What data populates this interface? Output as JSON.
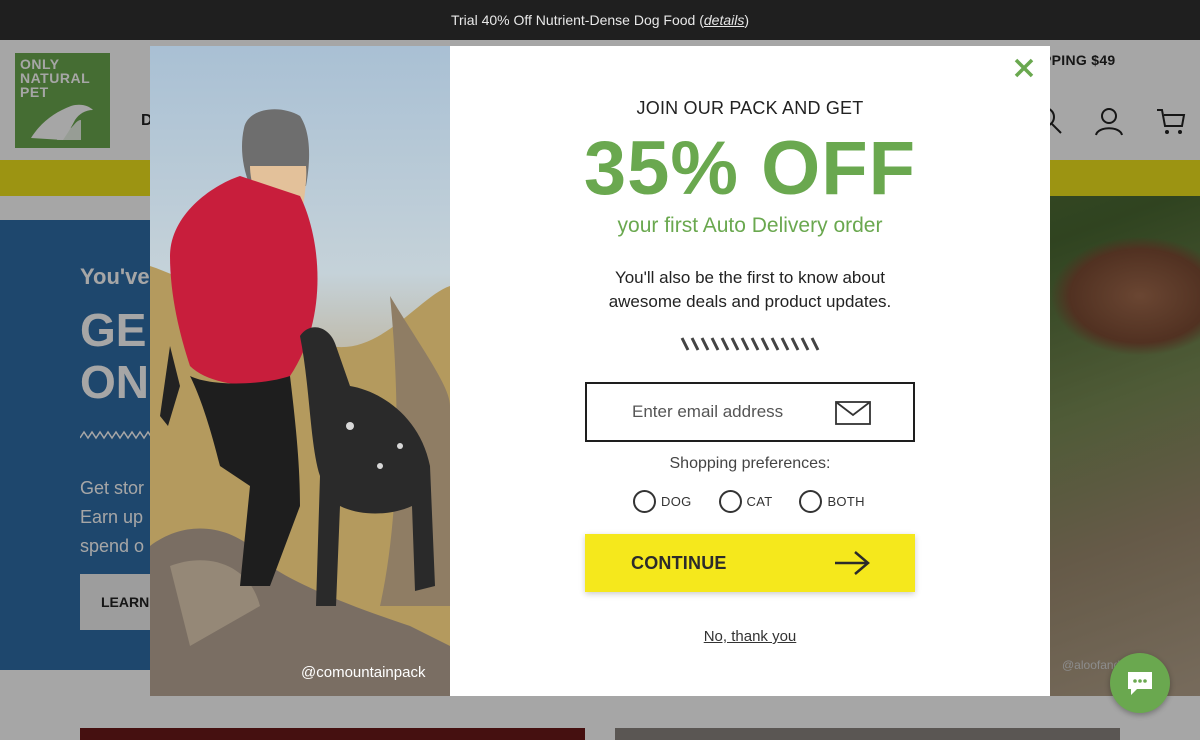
{
  "announcement": {
    "text": "Trial 40% Off Nutrient-Dense Dog Food (",
    "link": "details",
    "close": ")"
  },
  "header": {
    "logo_line1": "ONLY",
    "logo_line2": "NATURAL",
    "logo_line3": "PET",
    "nav_partial": "D",
    "shipping_partial": "PPING $49"
  },
  "hero": {
    "small": "You've",
    "big_line1": "GE",
    "big_line2": "ON",
    "body_line1": "Get stor",
    "body_line2": "Earn up",
    "body_line3": "spend o",
    "button": "LEARN",
    "credit": "@aloofandr"
  },
  "modal": {
    "pre_title": "JOIN OUR PACK AND GET",
    "big_title": "35% OFF",
    "sub_title": "your first Auto Delivery order",
    "desc_line1": "You'll also be the first to know about",
    "desc_line2": "awesome deals and product updates.",
    "email_placeholder": "Enter email address",
    "pref_label": "Shopping preferences:",
    "options": [
      "DOG",
      "CAT",
      "BOTH"
    ],
    "continue": "CONTINUE",
    "no_thanks": "No, thank you",
    "photo_credit": "@comountainpack"
  },
  "colors": {
    "brand_green": "#6aa84f",
    "cta_yellow": "#f5e81c",
    "hero_blue": "#2e6da8",
    "topbar": "#1f1f1f"
  },
  "icons": [
    "close-icon",
    "mail-icon",
    "arrow-right-icon",
    "chat-icon",
    "search-icon",
    "account-icon",
    "cart-icon"
  ]
}
